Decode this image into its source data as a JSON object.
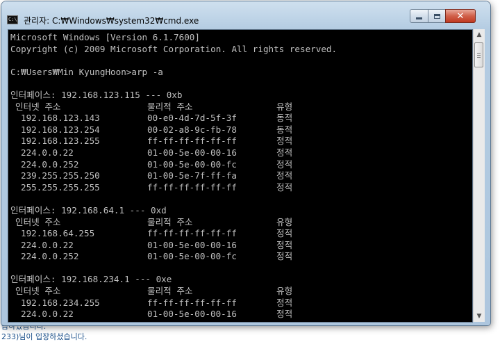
{
  "background": {
    "line1": "습하였습니다.",
    "line2": "233)님이 입장하셨습니다."
  },
  "window": {
    "title": "관리자: C:₩Windows₩system32₩cmd.exe",
    "icon": "console-window-icon",
    "controls": {
      "minimize": "minimize-icon",
      "maximize": "maximize-icon",
      "close": "close-icon"
    }
  },
  "console": {
    "header_lines": [
      "Microsoft Windows [Version 6.1.7600]",
      "Copyright (c) 2009 Microsoft Corporation. All rights reserved.",
      "",
      "C:₩Users₩Min KyungHoon>arp -a",
      ""
    ],
    "column_headers": {
      "ip": "인터넷 주소",
      "mac": "물리적 주소",
      "type": "유형"
    },
    "interfaces": [
      {
        "label": "인터페이스: 192.168.123.115 --- 0xb",
        "entries": [
          {
            "ip": "192.168.123.143",
            "mac": "00-e0-4d-7d-5f-3f",
            "type": "동적"
          },
          {
            "ip": "192.168.123.254",
            "mac": "00-02-a8-9c-fb-78",
            "type": "동적"
          },
          {
            "ip": "192.168.123.255",
            "mac": "ff-ff-ff-ff-ff-ff",
            "type": "정적"
          },
          {
            "ip": "224.0.0.22",
            "mac": "01-00-5e-00-00-16",
            "type": "정적"
          },
          {
            "ip": "224.0.0.252",
            "mac": "01-00-5e-00-00-fc",
            "type": "정적"
          },
          {
            "ip": "239.255.255.250",
            "mac": "01-00-5e-7f-ff-fa",
            "type": "정적"
          },
          {
            "ip": "255.255.255.255",
            "mac": "ff-ff-ff-ff-ff-ff",
            "type": "정적"
          }
        ]
      },
      {
        "label": "인터페이스: 192.168.64.1 --- 0xd",
        "entries": [
          {
            "ip": "192.168.64.255",
            "mac": "ff-ff-ff-ff-ff-ff",
            "type": "정적"
          },
          {
            "ip": "224.0.0.22",
            "mac": "01-00-5e-00-00-16",
            "type": "정적"
          },
          {
            "ip": "224.0.0.252",
            "mac": "01-00-5e-00-00-fc",
            "type": "정적"
          }
        ]
      },
      {
        "label": "인터페이스: 192.168.234.1 --- 0xe",
        "entries": [
          {
            "ip": "192.168.234.255",
            "mac": "ff-ff-ff-ff-ff-ff",
            "type": "정적"
          },
          {
            "ip": "224.0.0.22",
            "mac": "01-00-5e-00-00-16",
            "type": "정적"
          }
        ]
      }
    ]
  },
  "scrollbar": {
    "up": "scroll-up-arrow-icon",
    "down": "scroll-down-arrow-icon"
  }
}
